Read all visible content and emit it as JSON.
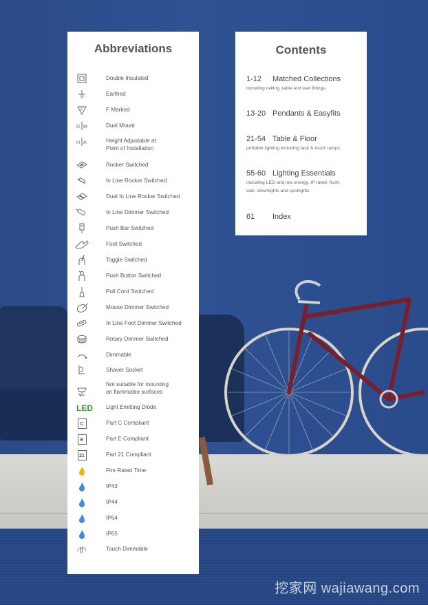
{
  "abbreviations": {
    "title": "Abbreviations",
    "items": [
      {
        "icon": "double-insulated-icon",
        "label": "Double Insulated"
      },
      {
        "icon": "earthed-icon",
        "label": "Earthed"
      },
      {
        "icon": "f-marked-icon",
        "label": "F Marked"
      },
      {
        "icon": "dual-mount-icon",
        "label": "Dual Mount"
      },
      {
        "icon": "height-adjustable-icon",
        "label": "Height Adjustable at",
        "label2": "Point of Installation"
      },
      {
        "icon": "rocker-switch-icon",
        "label": "Rocker Switched"
      },
      {
        "icon": "inline-rocker-icon",
        "label": "In Line Rocker Switched"
      },
      {
        "icon": "dual-inline-rocker-icon",
        "label": "Dual In Line Rocker Switched"
      },
      {
        "icon": "inline-dimmer-icon",
        "label": "In Line Dimmer Switched"
      },
      {
        "icon": "push-bar-icon",
        "label": "Push Bar Switched"
      },
      {
        "icon": "foot-switch-icon",
        "label": "Foot Switched"
      },
      {
        "icon": "toggle-switch-icon",
        "label": "Toggle Switched"
      },
      {
        "icon": "push-button-icon",
        "label": "Push Button Switched"
      },
      {
        "icon": "pull-cord-icon",
        "label": "Pull Cord Switched"
      },
      {
        "icon": "mouse-dimmer-icon",
        "label": "Mouse Dimmer Switched"
      },
      {
        "icon": "inline-foot-dimmer-icon",
        "label": "In Line Foot Dimmer Switched"
      },
      {
        "icon": "rotary-dimmer-icon",
        "label": "Rotary Dimmer Switched"
      },
      {
        "icon": "dimmable-icon",
        "label": "Dimmable"
      },
      {
        "icon": "shaver-socket-icon",
        "label": "Shaver Socket"
      },
      {
        "icon": "not-flammable-surface-icon",
        "label": "Not suitable for mounting",
        "label2": "on flammable surfaces"
      },
      {
        "icon": "led-icon",
        "icon_text": "LED",
        "label": "Light Emitting Diode"
      },
      {
        "icon": "part-c-icon",
        "icon_text": "C",
        "label": "Part C Compliant"
      },
      {
        "icon": "part-e-icon",
        "icon_text": "E",
        "label": "Part E Compliant"
      },
      {
        "icon": "part-21-icon",
        "icon_text": "21",
        "label": "Part 21 Compliant"
      },
      {
        "icon": "fire-rated-icon",
        "label": "Fire Rated Time"
      },
      {
        "icon": "ip43-icon",
        "label": "IP43"
      },
      {
        "icon": "ip44-icon",
        "label": "IP44"
      },
      {
        "icon": "ip64-icon",
        "label": "IP64"
      },
      {
        "icon": "ip65-icon",
        "label": "IP65"
      },
      {
        "icon": "touch-dimmable-icon",
        "label": "Touch Dimmable"
      }
    ]
  },
  "contents": {
    "title": "Contents",
    "entries": [
      {
        "range": "1-12",
        "title": "Matched Collections",
        "sub": "including ceiling, table and wall fittings"
      },
      {
        "range": "13-20",
        "title": "Pendants & Easyfits",
        "sub": ""
      },
      {
        "range": "21-54",
        "title": "Table & Floor",
        "sub": "portable lighting including task & touch lamps"
      },
      {
        "range": "55-60",
        "title": "Lighting Essentials",
        "sub": "including LED and low energy, IP rated, flush,",
        "sub2": "wall, downlights and spotlights"
      },
      {
        "range": "61",
        "title": "Index",
        "sub": ""
      }
    ]
  },
  "colors": {
    "led": "#2e9b3a",
    "fire": "#f0b400",
    "ip": "#3a8fd6",
    "wall": "#2f5294"
  },
  "watermark": "挖家网 wajiawang.com"
}
